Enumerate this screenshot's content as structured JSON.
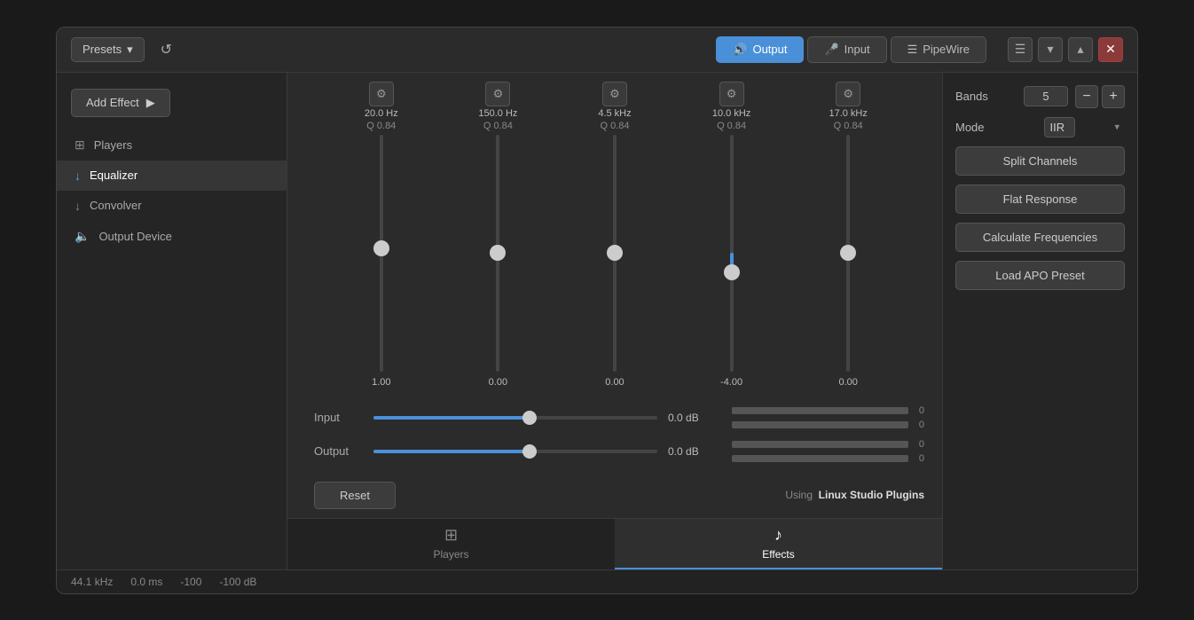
{
  "header": {
    "presets_label": "Presets",
    "tabs": [
      {
        "id": "output",
        "label": "Output",
        "icon": "🔊",
        "active": true
      },
      {
        "id": "input",
        "label": "Input",
        "icon": "🎤",
        "active": false
      },
      {
        "id": "pipewire",
        "label": "PipeWire",
        "icon": "☰",
        "active": false
      }
    ]
  },
  "sidebar": {
    "add_effect_label": "Add Effect",
    "items": [
      {
        "id": "players",
        "label": "Players",
        "icon": "⊞",
        "active": false
      },
      {
        "id": "equalizer",
        "label": "Equalizer",
        "icon": "↓",
        "active": true
      },
      {
        "id": "convolver",
        "label": "Convolver",
        "icon": "↓",
        "active": false
      },
      {
        "id": "output_device",
        "label": "Output Device",
        "icon": "🔈",
        "active": false
      }
    ]
  },
  "eq": {
    "bands": [
      {
        "freq": "20.0 Hz",
        "q": "Q 0.84",
        "value": "1.00",
        "db": 1.0
      },
      {
        "freq": "150.0 Hz",
        "q": "Q 0.84",
        "value": "0.00",
        "db": 0.0
      },
      {
        "freq": "4.5 kHz",
        "q": "Q 0.84",
        "value": "0.00",
        "db": 0.0
      },
      {
        "freq": "10.0 kHz",
        "q": "Q 0.84",
        "value": "-4.00",
        "db": -4.0
      },
      {
        "freq": "17.0 kHz",
        "q": "Q 0.84",
        "value": "0.00",
        "db": 0.0
      }
    ],
    "input": {
      "label": "Input",
      "db_label": "0.0 dB",
      "value_pct": 55
    },
    "output": {
      "label": "Output",
      "db_label": "0.0 dB",
      "value_pct": 55
    }
  },
  "right_panel": {
    "bands_label": "Bands",
    "bands_value": "5",
    "mode_label": "Mode",
    "mode_value": "IIR",
    "split_channels_label": "Split Channels",
    "flat_response_label": "Flat Response",
    "calculate_freq_label": "Calculate Frequencies",
    "load_apo_label": "Load APO Preset"
  },
  "bottom": {
    "reset_label": "Reset",
    "using_prefix": "Using",
    "using_plugin": "Linux Studio Plugins"
  },
  "footer_tabs": [
    {
      "id": "players",
      "label": "Players",
      "icon": "⊞",
      "active": false
    },
    {
      "id": "effects",
      "label": "Effects",
      "icon": "♪",
      "active": true
    }
  ],
  "status_bar": {
    "sample_rate": "44.1 kHz",
    "latency": "0.0 ms",
    "val1": "-100",
    "val2": "-100 dB"
  }
}
